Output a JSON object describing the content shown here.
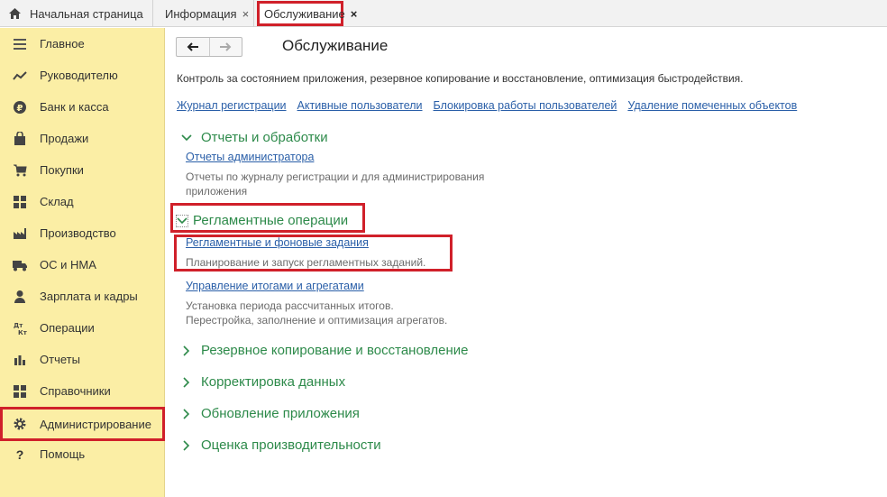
{
  "tabs": {
    "home": "Начальная страница",
    "info": "Информация",
    "service": "Обслуживание",
    "close_glyph": "×"
  },
  "sidebar": {
    "items": [
      {
        "label": "Главное",
        "icon": "menu-icon"
      },
      {
        "label": "Руководителю",
        "icon": "trend-icon"
      },
      {
        "label": "Банк и касса",
        "icon": "ruble-icon"
      },
      {
        "label": "Продажи",
        "icon": "bag-icon"
      },
      {
        "label": "Покупки",
        "icon": "cart-icon"
      },
      {
        "label": "Склад",
        "icon": "warehouse-icon"
      },
      {
        "label": "Производство",
        "icon": "factory-icon"
      },
      {
        "label": "ОС и НМА",
        "icon": "truck-icon"
      },
      {
        "label": "Зарплата и кадры",
        "icon": "person-icon"
      },
      {
        "label": "Операции",
        "icon": "dt-kt-icon"
      },
      {
        "label": "Отчеты",
        "icon": "bar-chart-icon"
      },
      {
        "label": "Справочники",
        "icon": "books-icon"
      },
      {
        "label": "Администрирование",
        "icon": "gear-icon"
      },
      {
        "label": "Помощь",
        "icon": "question-icon"
      }
    ]
  },
  "main": {
    "title": "Обслуживание",
    "description": "Контроль за состоянием приложения, резервное копирование и восстановление, оптимизация быстродействия.",
    "links": [
      "Журнал регистрации",
      "Активные пользователи",
      "Блокировка работы пользователей",
      "Удаление помеченных объектов"
    ],
    "sections": [
      {
        "title": "Отчеты и обработки",
        "expanded": true,
        "items": [
          {
            "link": "Отчеты администратора",
            "desc_lines": [
              "Отчеты по журналу регистрации и для администрирования",
              "приложения"
            ]
          }
        ]
      },
      {
        "title": "Регламентные операции",
        "expanded": true,
        "items": [
          {
            "link": "Регламентные и фоновые задания",
            "desc_lines": [
              "Планирование и запуск регламентных заданий."
            ]
          },
          {
            "link": "Управление итогами и агрегатами",
            "desc_lines": [
              "Установка периода рассчитанных итогов.",
              "Перестройка, заполнение и оптимизация агрегатов."
            ]
          }
        ]
      },
      {
        "title": "Резервное копирование и восстановление",
        "expanded": false
      },
      {
        "title": "Корректировка данных",
        "expanded": false
      },
      {
        "title": "Обновление приложения",
        "expanded": false
      },
      {
        "title": "Оценка производительности",
        "expanded": false
      }
    ]
  },
  "colors": {
    "accent_green": "#2d8a4a",
    "link_blue": "#2a5fa8",
    "sidebar_bg": "#fbeea5",
    "highlight_red": "#d0202a"
  }
}
